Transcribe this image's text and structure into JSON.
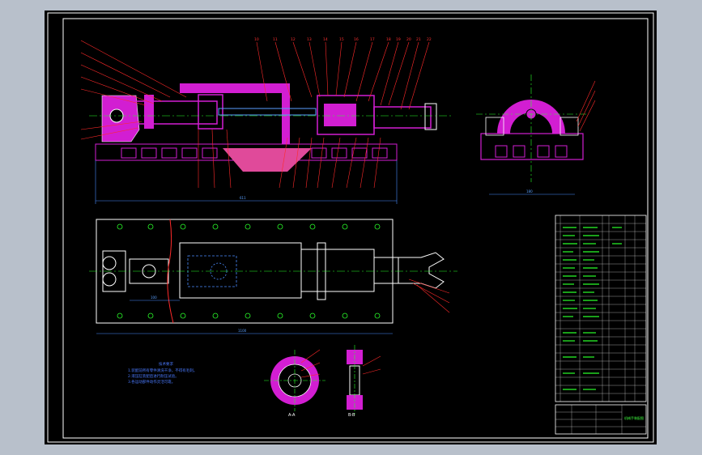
{
  "drawing": {
    "background": "#000000",
    "frame_color": "#ffffff",
    "part_color": "#d21ed2",
    "line_color": "#ff2a2a",
    "center_color": "#2aff2a",
    "dim_color": "#4a8cff",
    "section_color": "#e04a9a"
  },
  "front_view": {
    "top_numbers": [
      "10",
      "11",
      "12",
      "13",
      "14",
      "15",
      "16",
      "17",
      "18",
      "19",
      "20",
      "21",
      "22"
    ],
    "dim_total": "611"
  },
  "end_view": {
    "dim_width": "180"
  },
  "plan_view": {
    "dim_length": "1100",
    "dim_left": "100"
  },
  "section_views": {
    "left_label": "A-A",
    "right_label": "B-B"
  },
  "notes": {
    "heading": "技术要求",
    "lines": [
      "1.装配前所有零件清洗干净，不得有毛刺。",
      "2.液压缸装配后进行耐压试验。",
      "3.各运动部件动作灵活可靠。"
    ]
  },
  "title_block": {
    "title": "机械手装配图"
  }
}
